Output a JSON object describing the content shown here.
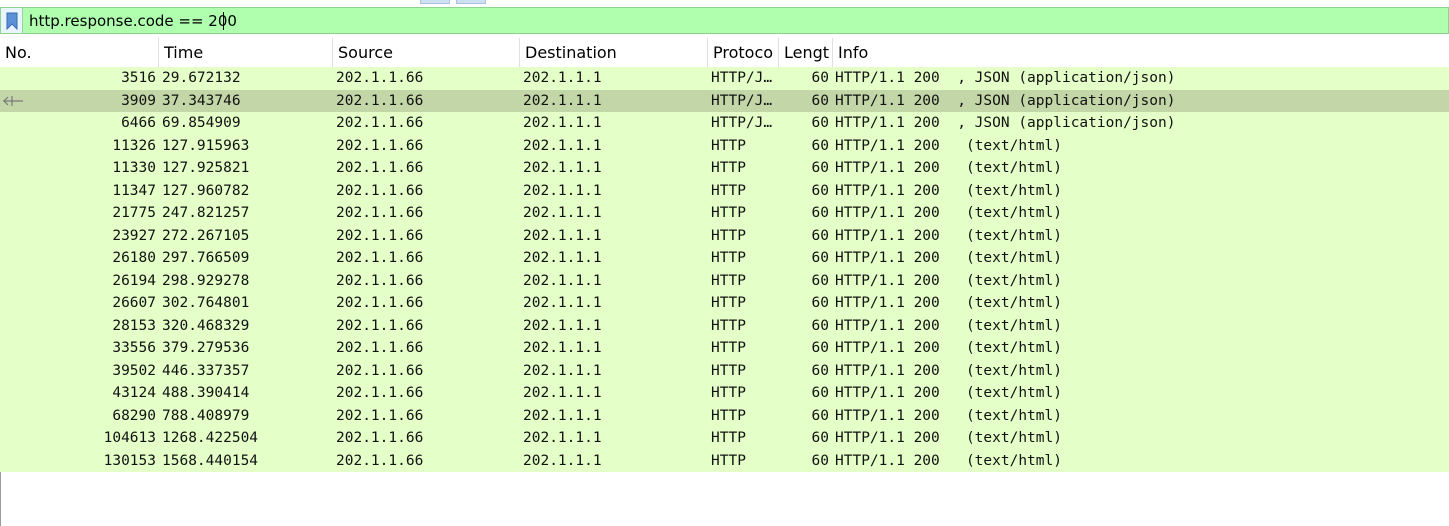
{
  "filter": {
    "value": "http.response.code == 200"
  },
  "columns": [
    "No.",
    "Time",
    "Source",
    "Destination",
    "Protoco",
    "Lengt",
    "Info"
  ],
  "colors": {
    "filter_valid": "#afffaf",
    "row_bg": "#e4ffc7",
    "row_selected": "#c3d6a7"
  },
  "packets": [
    {
      "no": "3516",
      "time": "29.672132",
      "source": "202.1.1.66",
      "destination": "202.1.1.1",
      "protocol": "HTTP/J…",
      "length": "60",
      "info": "HTTP/1.1 200  , JSON (application/json)"
    },
    {
      "no": "3909",
      "time": "37.343746",
      "source": "202.1.1.66",
      "destination": "202.1.1.1",
      "protocol": "HTTP/J…",
      "length": "60",
      "info": "HTTP/1.1 200  , JSON (application/json)"
    },
    {
      "no": "6466",
      "time": "69.854909",
      "source": "202.1.1.66",
      "destination": "202.1.1.1",
      "protocol": "HTTP/J…",
      "length": "60",
      "info": "HTTP/1.1 200  , JSON (application/json)"
    },
    {
      "no": "11326",
      "time": "127.915963",
      "source": "202.1.1.66",
      "destination": "202.1.1.1",
      "protocol": "HTTP",
      "length": "60",
      "info": "HTTP/1.1 200   (text/html)"
    },
    {
      "no": "11330",
      "time": "127.925821",
      "source": "202.1.1.66",
      "destination": "202.1.1.1",
      "protocol": "HTTP",
      "length": "60",
      "info": "HTTP/1.1 200   (text/html)"
    },
    {
      "no": "11347",
      "time": "127.960782",
      "source": "202.1.1.66",
      "destination": "202.1.1.1",
      "protocol": "HTTP",
      "length": "60",
      "info": "HTTP/1.1 200   (text/html)"
    },
    {
      "no": "21775",
      "time": "247.821257",
      "source": "202.1.1.66",
      "destination": "202.1.1.1",
      "protocol": "HTTP",
      "length": "60",
      "info": "HTTP/1.1 200   (text/html)"
    },
    {
      "no": "23927",
      "time": "272.267105",
      "source": "202.1.1.66",
      "destination": "202.1.1.1",
      "protocol": "HTTP",
      "length": "60",
      "info": "HTTP/1.1 200   (text/html)"
    },
    {
      "no": "26180",
      "time": "297.766509",
      "source": "202.1.1.66",
      "destination": "202.1.1.1",
      "protocol": "HTTP",
      "length": "60",
      "info": "HTTP/1.1 200   (text/html)"
    },
    {
      "no": "26194",
      "time": "298.929278",
      "source": "202.1.1.66",
      "destination": "202.1.1.1",
      "protocol": "HTTP",
      "length": "60",
      "info": "HTTP/1.1 200   (text/html)"
    },
    {
      "no": "26607",
      "time": "302.764801",
      "source": "202.1.1.66",
      "destination": "202.1.1.1",
      "protocol": "HTTP",
      "length": "60",
      "info": "HTTP/1.1 200   (text/html)"
    },
    {
      "no": "28153",
      "time": "320.468329",
      "source": "202.1.1.66",
      "destination": "202.1.1.1",
      "protocol": "HTTP",
      "length": "60",
      "info": "HTTP/1.1 200   (text/html)"
    },
    {
      "no": "33556",
      "time": "379.279536",
      "source": "202.1.1.66",
      "destination": "202.1.1.1",
      "protocol": "HTTP",
      "length": "60",
      "info": "HTTP/1.1 200   (text/html)"
    },
    {
      "no": "39502",
      "time": "446.337357",
      "source": "202.1.1.66",
      "destination": "202.1.1.1",
      "protocol": "HTTP",
      "length": "60",
      "info": "HTTP/1.1 200   (text/html)"
    },
    {
      "no": "43124",
      "time": "488.390414",
      "source": "202.1.1.66",
      "destination": "202.1.1.1",
      "protocol": "HTTP",
      "length": "60",
      "info": "HTTP/1.1 200   (text/html)"
    },
    {
      "no": "68290",
      "time": "788.408979",
      "source": "202.1.1.66",
      "destination": "202.1.1.1",
      "protocol": "HTTP",
      "length": "60",
      "info": "HTTP/1.1 200   (text/html)"
    },
    {
      "no": "104613",
      "time": "1268.422504",
      "source": "202.1.1.66",
      "destination": "202.1.1.1",
      "protocol": "HTTP",
      "length": "60",
      "info": "HTTP/1.1 200   (text/html)"
    },
    {
      "no": "130153",
      "time": "1568.440154",
      "source": "202.1.1.66",
      "destination": "202.1.1.1",
      "protocol": "HTTP",
      "length": "60",
      "info": "HTTP/1.1 200   (text/html)"
    }
  ]
}
